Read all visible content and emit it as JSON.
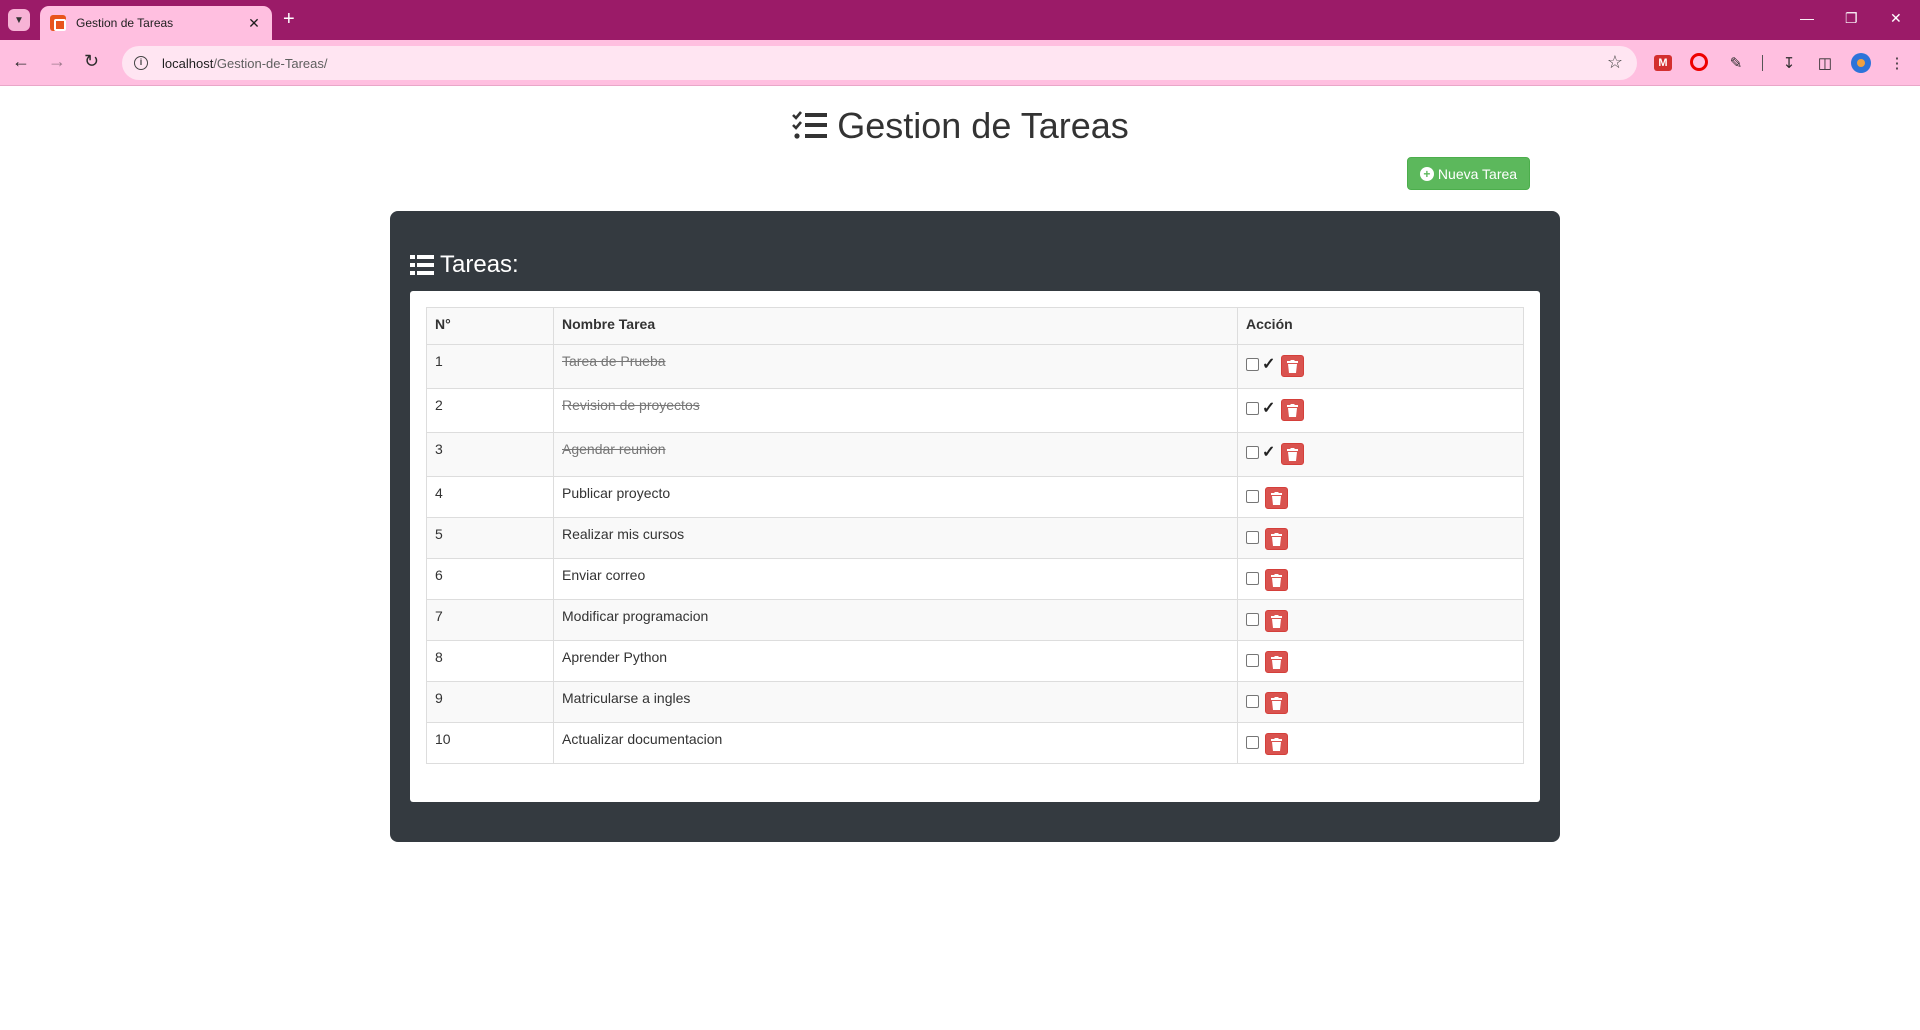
{
  "browser": {
    "tab_title": "Gestion de Tareas",
    "url_host": "localhost",
    "url_path": "/Gestion-de-Tareas/",
    "accent_color": "#9b1b68",
    "toolbar_color": "#ffbfe0"
  },
  "header": {
    "title": "Gestion de Tareas",
    "new_task_label": "Nueva Tarea"
  },
  "panel": {
    "title": "Tareas:"
  },
  "table": {
    "columns": [
      "N°",
      "Nombre Tarea",
      "Acción"
    ],
    "rows": [
      {
        "n": "1",
        "name": "Tarea de Prueba",
        "done": true
      },
      {
        "n": "2",
        "name": "Revision de proyectos",
        "done": true
      },
      {
        "n": "3",
        "name": "Agendar reunion",
        "done": true
      },
      {
        "n": "4",
        "name": "Publicar proyecto",
        "done": false
      },
      {
        "n": "5",
        "name": "Realizar mis cursos",
        "done": false
      },
      {
        "n": "6",
        "name": "Enviar correo",
        "done": false
      },
      {
        "n": "7",
        "name": "Modificar programacion",
        "done": false
      },
      {
        "n": "8",
        "name": "Aprender Python",
        "done": false
      },
      {
        "n": "9",
        "name": "Matricularse a ingles",
        "done": false
      },
      {
        "n": "10",
        "name": "Actualizar documentacion",
        "done": false
      }
    ]
  },
  "colors": {
    "success": "#5cb85c",
    "danger": "#d9534f",
    "panel_dark": "#343a40"
  }
}
